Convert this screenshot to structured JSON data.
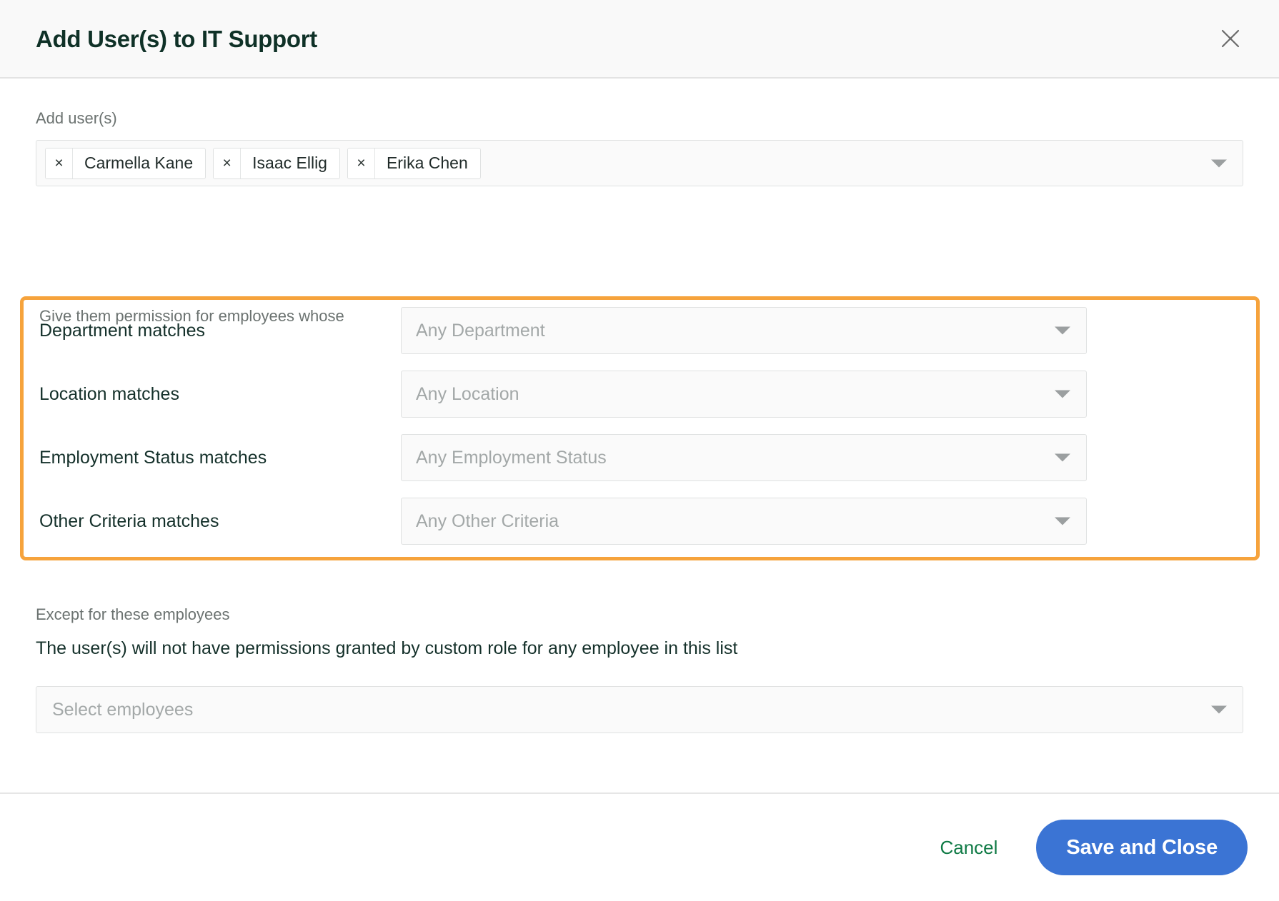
{
  "dialog": {
    "title": "Add User(s) to IT Support",
    "close_icon": "close-icon"
  },
  "add_users": {
    "label": "Add user(s)",
    "chips": [
      {
        "name": "Carmella Kane",
        "remove_icon": "×"
      },
      {
        "name": "Isaac Ellig",
        "remove_icon": "×"
      },
      {
        "name": "Erika Chen",
        "remove_icon": "×"
      }
    ],
    "dropdown_icon": "caret-down-icon"
  },
  "permission": {
    "intro": "Give them permission for employees whose",
    "highlight_color": "#f6a33c",
    "criteria": [
      {
        "label": "Department matches",
        "placeholder": "Any Department"
      },
      {
        "label": "Location matches",
        "placeholder": "Any Location"
      },
      {
        "label": "Employment Status matches",
        "placeholder": "Any Employment Status"
      },
      {
        "label": "Other Criteria matches",
        "placeholder": "Any Other Criteria"
      }
    ]
  },
  "except": {
    "title": "Except for these employees",
    "description": "The user(s) will not have permissions granted by custom role for any employee in this list",
    "placeholder": "Select employees"
  },
  "footer": {
    "cancel_label": "Cancel",
    "save_label": "Save and Close",
    "cancel_color": "#0f7a45",
    "save_color": "#3b74d4"
  }
}
